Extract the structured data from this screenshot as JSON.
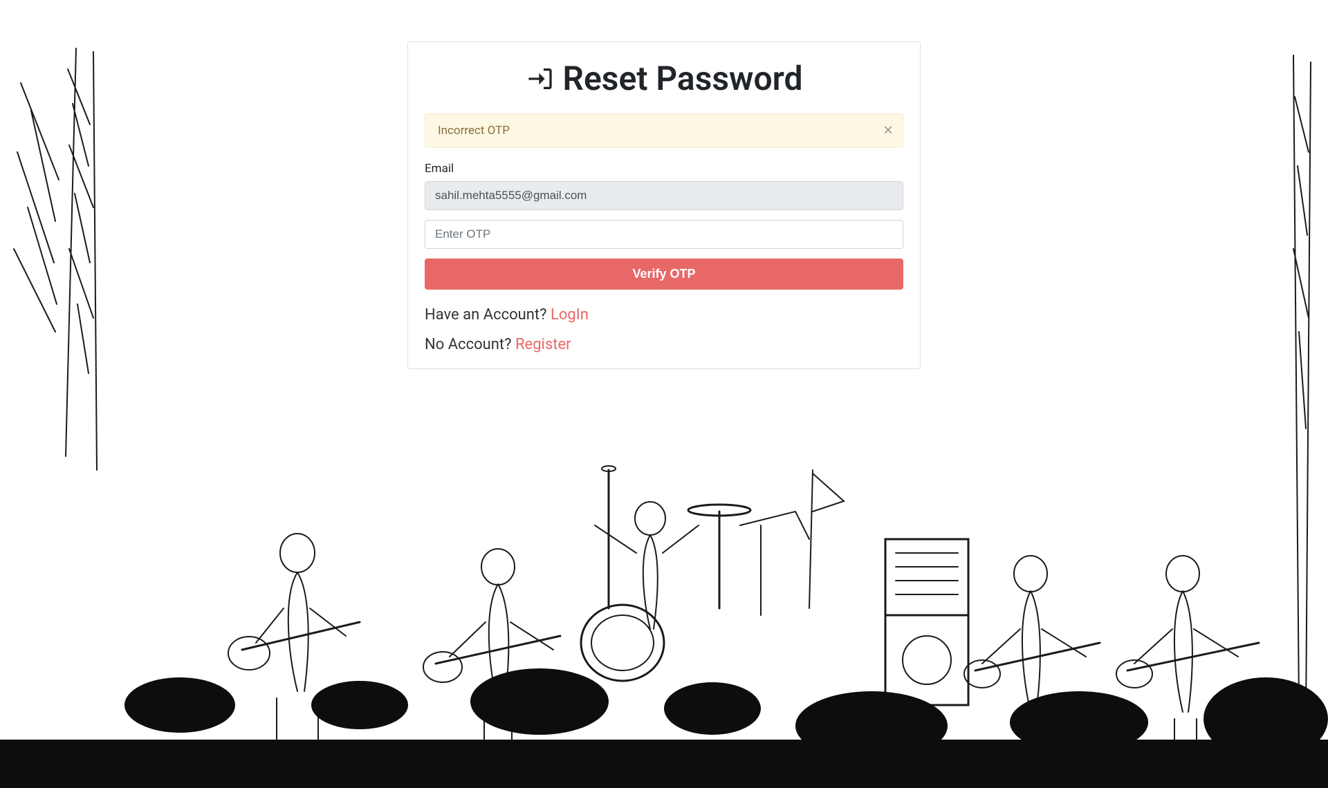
{
  "title": "Reset Password",
  "alert": {
    "message": "Incorrect OTP",
    "close": "×"
  },
  "form": {
    "email_label": "Email",
    "email_value": "sahil.mehta5555@gmail.com",
    "otp_placeholder": "Enter OTP",
    "submit_label": "Verify OTP"
  },
  "links": {
    "login_prompt": "Have an Account? ",
    "login_label": "LogIn",
    "register_prompt": "No Account? ",
    "register_label": "Register"
  }
}
